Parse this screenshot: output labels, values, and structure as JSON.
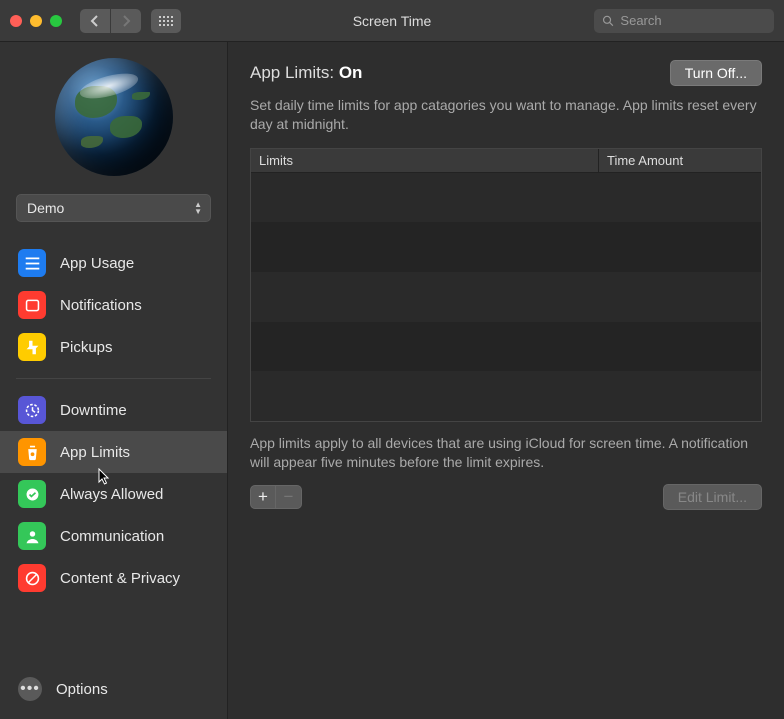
{
  "window": {
    "title": "Screen Time",
    "search_placeholder": "Search"
  },
  "sidebar": {
    "user_name": "Demo",
    "items": [
      {
        "label": "App Usage"
      },
      {
        "label": "Notifications"
      },
      {
        "label": "Pickups"
      },
      {
        "label": "Downtime"
      },
      {
        "label": "App Limits"
      },
      {
        "label": "Always Allowed"
      },
      {
        "label": "Communication"
      },
      {
        "label": "Content & Privacy"
      }
    ],
    "options_label": "Options"
  },
  "main": {
    "title_prefix": "App Limits: ",
    "title_state": "On",
    "turn_off_label": "Turn Off...",
    "description": "Set daily time limits for app catagories you want to manage. App limits reset every day at midnight.",
    "col_limits": "Limits",
    "col_time": "Time Amount",
    "footnote": "App limits apply to all devices that are using iCloud for screen time. A notification will appear five minutes before the limit expires.",
    "add_label": "+",
    "remove_label": "−",
    "edit_label": "Edit Limit..."
  }
}
